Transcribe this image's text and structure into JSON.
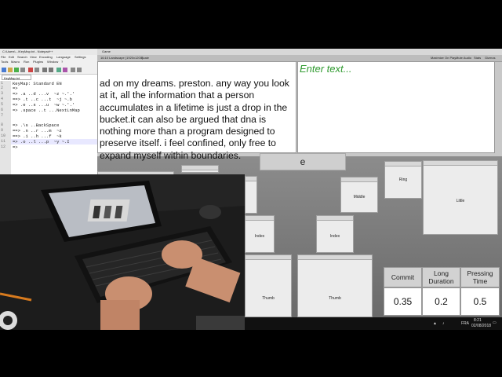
{
  "unity": {
    "window_tab": "Game",
    "resolution": "16:10 Landscape (1920x1200)",
    "scale": "Scale",
    "toolbar_right": [
      "Maximize On Play",
      "Mute Audio",
      "Stats",
      "Gizmos"
    ],
    "body_text": "ad on my dreams. preston. any way you look at it, all the information that a person accumulates in a lifetime is just a drop in the bucket.it can also be argued that dna is nothing more than a program designed to preserve itself. i feel confined, only free to expand myself within boundaries.",
    "input_placeholder": "Enter text...",
    "current_key": "e",
    "keys": [
      "Ring",
      "Middle",
      "Little",
      "Index",
      "Index",
      "Thumb",
      "Thumb"
    ],
    "metrics": {
      "headers": [
        "Commit",
        "Long Duration",
        "Pressing Time"
      ],
      "values": [
        "0.35",
        "0.2",
        "0.5"
      ]
    }
  },
  "notepad": {
    "title": "C:\\Users\\...\\KeyMap.txt - Notepad++",
    "menu": [
      "File",
      "Edit",
      "Search",
      "View",
      "Encoding",
      "Language",
      "Settings",
      "Tools",
      "Macro",
      "Run",
      "Plugins",
      "Window",
      "?"
    ],
    "tab": "KeyMap.txt",
    "lines": [
      {
        "n": "1",
        "code": "KeyMap: Standard EN"
      },
      {
        "n": "2",
        "code": "=>"
      },
      {
        "n": "3",
        "code": "=> .a ..d ...v  ~z ~.'.'"
      },
      {
        "n": "4",
        "code": "==> .t ..c ...t  ~j ~.b"
      },
      {
        "n": "5",
        "code": "=> .e ..s ...u  ~w ~.'.'"
      },
      {
        "n": "6",
        "code": "=> .space ..t ...NextLnMap"
      },
      {
        "n": "7",
        "code": ""
      },
      {
        "n": "8",
        "code": "=> .\\s ..BackSpace"
      },
      {
        "n": "9",
        "code": "==> .n ..r ...m  ~z"
      },
      {
        "n": "10",
        "code": "==> .i ..h ...f  ~k"
      },
      {
        "n": "11",
        "code": "=> .o ..l ...p  ~y ~.I"
      },
      {
        "n": "12",
        "code": "=>"
      }
    ]
  },
  "taskbar": {
    "lang": "FRA",
    "time": "8:21",
    "date": "02/08/2018"
  }
}
